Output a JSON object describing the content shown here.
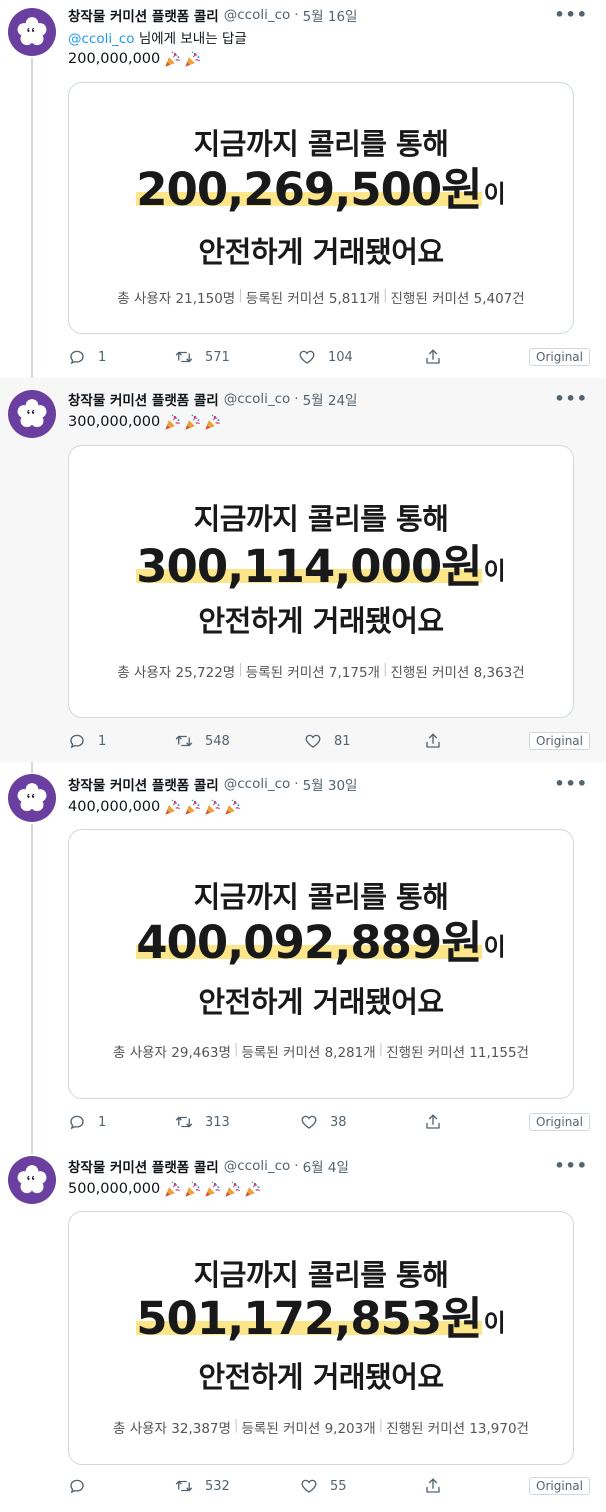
{
  "colors": {
    "avatar_bg": "#6b3fa0",
    "mention": "#1d9bf0",
    "amount_highlight": "#fde68a",
    "thread_line": "#cfd9de"
  },
  "icons": {
    "reply": "reply-icon",
    "retweet": "retweet-icon",
    "like": "heart-icon",
    "share": "share-icon",
    "more": "more-icon",
    "party": "party-popper-icon"
  },
  "tweets": [
    {
      "author_name": "창작물 커미션 플랫폼 콜리",
      "handle": "@ccoli_co",
      "separator": "·",
      "date": "5월 16일",
      "reply_mention": "@ccoli_co",
      "reply_text": " 님에게 보내는 답글",
      "text": "200,000,000",
      "party_count": 2,
      "card": {
        "line1": "지금까지 콜리를 통해",
        "amount": "200,269,500원",
        "suffix": "이",
        "line3": "안전하게 거래됐어요",
        "stat_users": "총 사용자 21,150명",
        "stat_registered": "등록된 커미션 5,811개",
        "stat_done": "진행된 커미션 5,407건"
      },
      "reply_count": "1",
      "retweet_count": "571",
      "like_count": "104",
      "original_label": "Original"
    },
    {
      "author_name": "창작물 커미션 플랫폼 콜리",
      "handle": "@ccoli_co",
      "separator": "·",
      "date": "5월 24일",
      "text": "300,000,000",
      "party_count": 3,
      "card": {
        "line1": "지금까지 콜리를 통해",
        "amount": "300,114,000원",
        "suffix": "이",
        "line3": "안전하게 거래됐어요",
        "stat_users": "총 사용자 25,722명",
        "stat_registered": "등록된 커미션 7,175개",
        "stat_done": "진행된 커미션 8,363건"
      },
      "reply_count": "1",
      "retweet_count": "548",
      "like_count": "81",
      "original_label": "Original"
    },
    {
      "author_name": "창작물 커미션 플랫폼 콜리",
      "handle": "@ccoli_co",
      "separator": "·",
      "date": "5월 30일",
      "text": "400,000,000",
      "party_count": 4,
      "card": {
        "line1": "지금까지 콜리를 통해",
        "amount": "400,092,889원",
        "suffix": "이",
        "line3": "안전하게 거래됐어요",
        "stat_users": "총 사용자 29,463명",
        "stat_registered": "등록된 커미션 8,281개",
        "stat_done": "진행된 커미션 11,155건"
      },
      "reply_count": "1",
      "retweet_count": "313",
      "like_count": "38",
      "original_label": "Original"
    },
    {
      "author_name": "창작물 커미션 플랫폼 콜리",
      "handle": "@ccoli_co",
      "separator": "·",
      "date": "6월 4일",
      "text": "500,000,000",
      "party_count": 5,
      "card": {
        "line1": "지금까지 콜리를 통해",
        "amount": "501,172,853원",
        "suffix": "이",
        "line3": "안전하게 거래됐어요",
        "stat_users": "총 사용자 32,387명",
        "stat_registered": "등록된 커미션 9,203개",
        "stat_done": "진행된 커미션 13,970건"
      },
      "reply_count": "",
      "retweet_count": "532",
      "like_count": "55",
      "original_label": "Original"
    }
  ]
}
